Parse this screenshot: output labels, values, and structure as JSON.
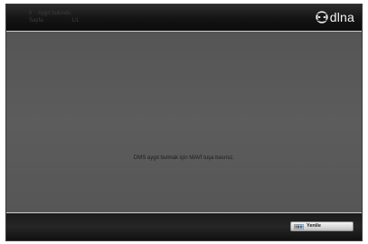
{
  "header": {
    "index_prefix": "0",
    "title": "Aygıt bulundu",
    "count_label": "Sayfa:",
    "count_value": "1/1",
    "logo_text": "dlna",
    "logo_icon": "dlna-logo-icon"
  },
  "main": {
    "message": "DMS aygıt bulmak için MAVİ tuşa basınız."
  },
  "footer": {
    "refresh_label": "Yenile",
    "refresh_icon": "blue-key-icon"
  },
  "colors": {
    "background": "#5a5a5a",
    "header": "#141414",
    "footer": "#1a1a1a",
    "button": "#d9d9d9",
    "text": "#1c1c1c"
  }
}
